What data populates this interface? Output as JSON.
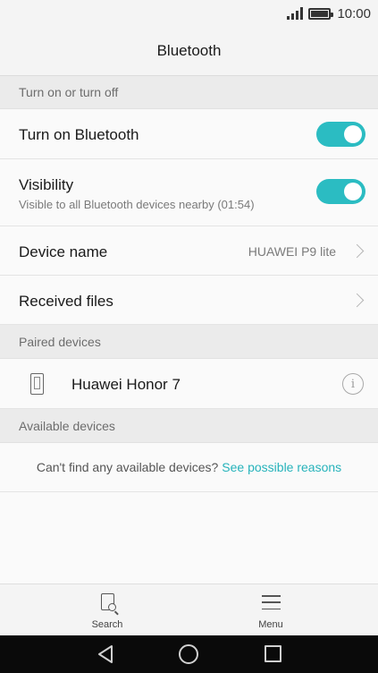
{
  "status_bar": {
    "time": "10:00"
  },
  "header": {
    "title": "Bluetooth"
  },
  "sections": {
    "toggle_section": "Turn on or turn off",
    "paired": "Paired devices",
    "available": "Available devices"
  },
  "settings": {
    "bluetooth": {
      "label": "Turn on Bluetooth",
      "enabled": true
    },
    "visibility": {
      "label": "Visibility",
      "sublabel": "Visible to all Bluetooth devices nearby (01:54)",
      "enabled": true
    },
    "device_name": {
      "label": "Device name",
      "value": "HUAWEI P9 lite"
    },
    "received_files": {
      "label": "Received files"
    }
  },
  "paired_devices": [
    {
      "name": "Huawei Honor 7",
      "icon": "phone-icon"
    }
  ],
  "available_hint": {
    "text": "Can't find any available devices?",
    "link": "See possible reasons"
  },
  "bottom_bar": {
    "search_label": "Search",
    "menu_label": "Menu"
  },
  "colors": {
    "accent": "#2bbcc2",
    "link": "#26b3bb"
  }
}
